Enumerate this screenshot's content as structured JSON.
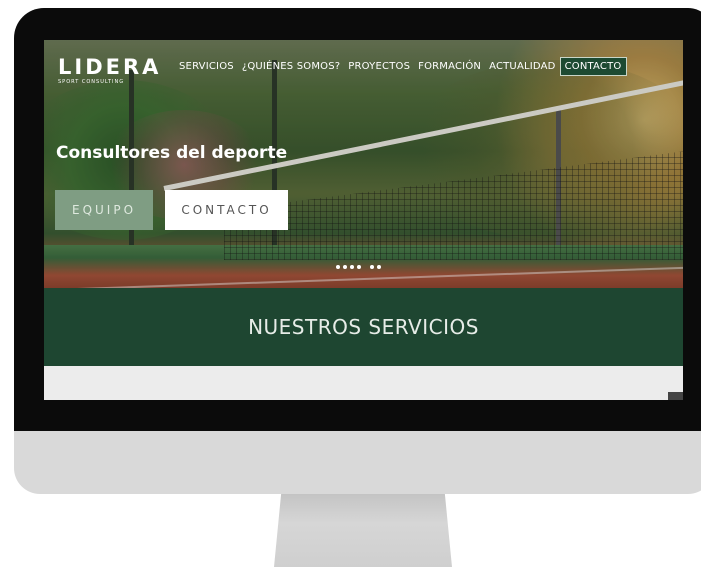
{
  "header": {
    "logo_word": "LIDERA",
    "logo_tagline": "SPORT CONSULTING",
    "nav": [
      {
        "label": "SERVICIOS"
      },
      {
        "label": "¿QUIÉNES SOMOS?"
      },
      {
        "label": "PROYECTOS"
      },
      {
        "label": "FORMACIÓN"
      },
      {
        "label": "ACTUALIDAD"
      },
      {
        "label": "CONTACTO",
        "active": true
      }
    ]
  },
  "hero": {
    "headline": "Consultores del deporte",
    "buttons": {
      "team_label": "EQUIPO",
      "contact_label": "CONTACTO"
    },
    "slider_dots": 6
  },
  "services": {
    "title": "NUESTROS SERVICIOS"
  },
  "colors": {
    "brand_green": "#1e4631",
    "button_green": "#7f9d83",
    "monitor_body": "#d9d9d9",
    "bezel": "#0b0b0b"
  }
}
